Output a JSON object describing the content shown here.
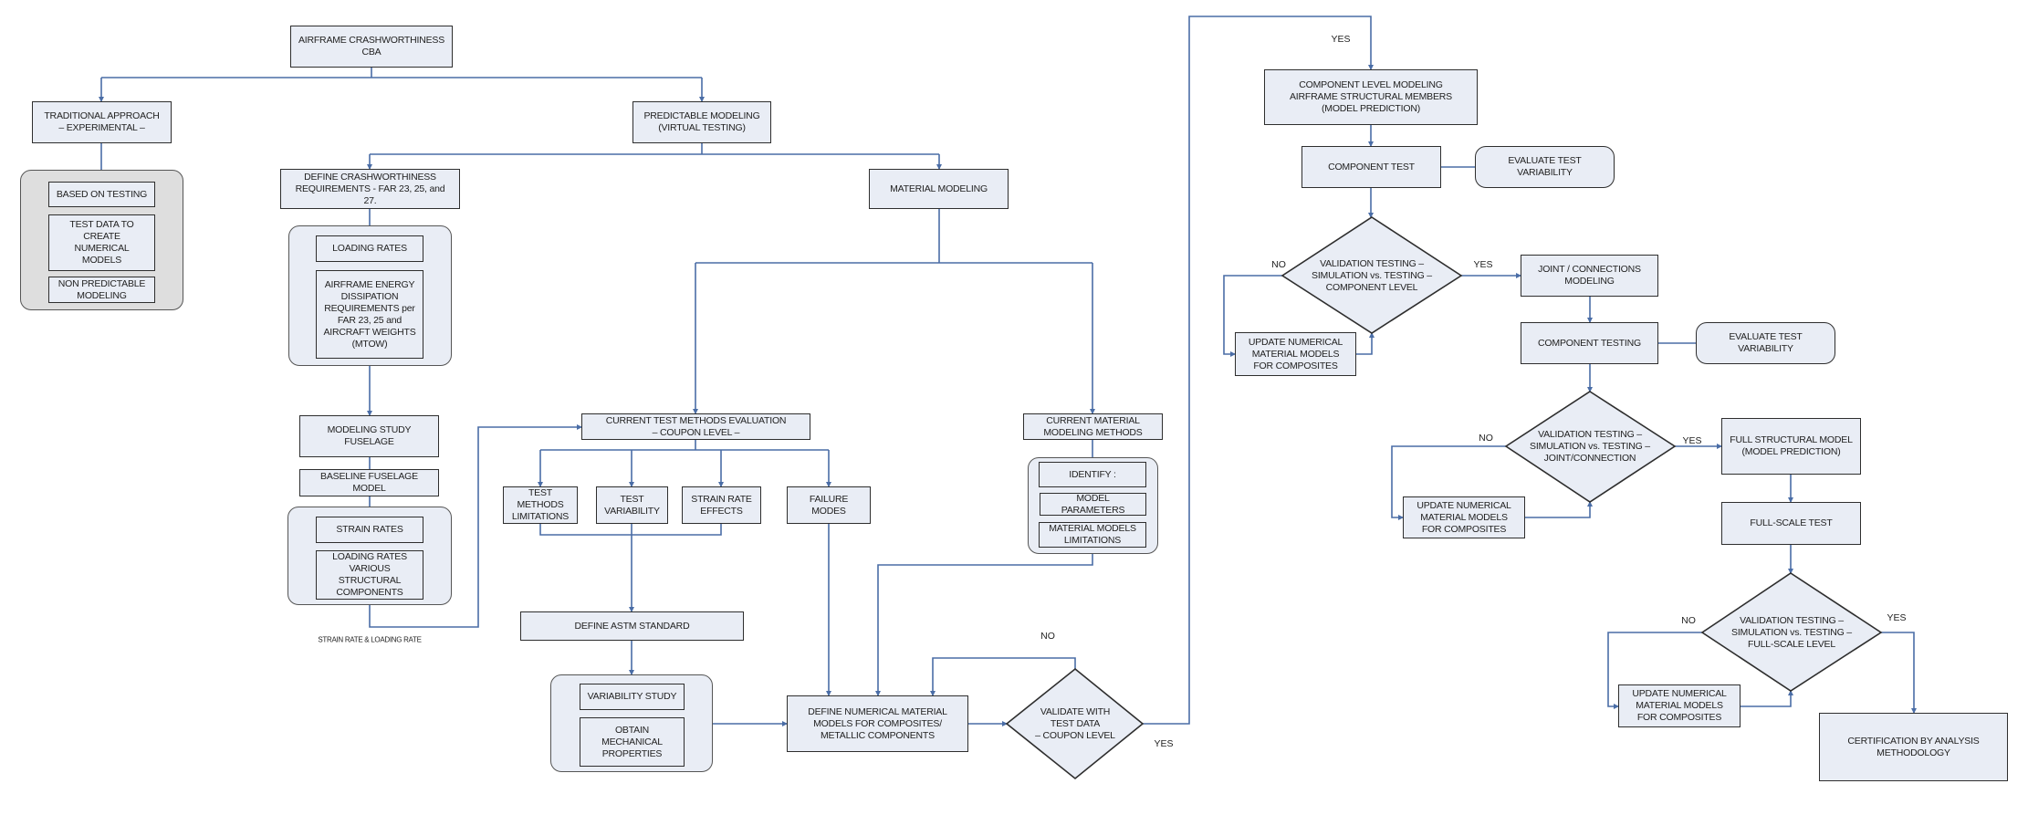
{
  "colors": {
    "box_fill": "#e9edf5",
    "group_gray": "#dedede",
    "connector": "#4a6da6",
    "border": "#2e2e2e"
  },
  "nodes": {
    "root": "AIRFRAME CRASHWORTHINESS\nCBA",
    "traditional": "TRADITIONAL APPROACH\n– EXPERIMENTAL –",
    "based_on_testing": "BASED ON TESTING",
    "test_data": "TEST DATA TO\nCREATE\nNUMERICAL\nMODELS",
    "non_predictable": "NON PREDICTABLE\nMODELING",
    "predictable": "PREDICTABLE MODELING\n(VIRTUAL TESTING)",
    "define_requirements": "DEFINE CRASHWORTHINESS\nREQUIREMENTS -  FAR 23, 25, and\n27.",
    "loading_rates": "LOADING RATES",
    "energy_dissipation": "AIRFRAME ENERGY\nDISSIPATION\nREQUIREMENTS per\nFAR 23, 25 and\nAIRCRAFT WEIGHTS\n(MTOW)",
    "material_modeling": "MATERIAL MODELING",
    "modeling_study": "MODELING STUDY\nFUSELAGE",
    "baseline_fuselage": "BASELINE FUSELAGE\nMODEL",
    "strain_rates": "STRAIN RATES",
    "loading_rates_components": "LOADING RATES\nVARIOUS\nSTRUCTURAL\nCOMPONENTS",
    "strain_loading_label": "STRAIN RATE & LOADING RATE",
    "current_test_methods": "CURRENT TEST METHODS EVALUATION\n– COUPON LEVEL –",
    "test_methods_limitations": "TEST\nMETHODS\nLIMITATIONS",
    "test_variability": "TEST\nVARIABILITY",
    "strain_rate_effects": "STRAIN RATE\nEFFECTS",
    "failure_modes": "FAILURE\nMODES",
    "define_astm": "DEFINE ASTM STANDARD",
    "variability_study": "VARIABILITY STUDY",
    "obtain_properties": "OBTAIN\nMECHANICAL\nPROPERTIES",
    "current_material_methods": "CURRENT MATERIAL\nMODELING METHODS",
    "identify": "IDENTIFY :",
    "model_parameters": "MODEL\nPARAMETERS",
    "material_limitations": "MATERIAL MODELS\nLIMITATIONS",
    "define_numerical": "DEFINE NUMERICAL MATERIAL\nMODELS FOR COMPOSITES/\nMETALLIC COMPONENTS",
    "validate_coupon": "VALIDATE WITH\nTEST DATA\n– COUPON LEVEL",
    "component_level": "COMPONENT LEVEL MODELING\nAIRFRAME STRUCTURAL MEMBERS\n(MODEL PREDICTION)",
    "component_test": "COMPONENT TEST",
    "evaluate_variability_1": "EVALUATE TEST\nVARIABILITY",
    "validation_component": "VALIDATION TESTING –\nSIMULATION vs. TESTING –\nCOMPONENT LEVEL",
    "update_1": "UPDATE NUMERICAL\nMATERIAL MODELS\nFOR COMPOSITES",
    "joint_modeling": "JOINT / CONNECTIONS\nMODELING",
    "component_testing": "COMPONENT TESTING",
    "evaluate_variability_2": "EVALUATE TEST\nVARIABILITY",
    "validation_joint": "VALIDATION TESTING –\nSIMULATION vs. TESTING –\nJOINT/CONNECTION",
    "update_2": "UPDATE NUMERICAL\nMATERIAL MODELS\nFOR COMPOSITES",
    "full_structural": "FULL STRUCTURAL MODEL\n(MODEL PREDICTION)",
    "full_scale_test": "FULL-SCALE TEST",
    "validation_full_scale": "VALIDATION TESTING –\nSIMULATION vs. TESTING –\nFULL-SCALE LEVEL",
    "update_3": "UPDATE NUMERICAL\nMATERIAL MODELS\nFOR COMPOSITES",
    "certification": "CERTIFICATION BY ANALYSIS\nMETHODOLOGY"
  },
  "edge_labels": {
    "coupon_no": "NO",
    "coupon_yes": "YES",
    "top_yes": "YES",
    "component_no": "NO",
    "component_yes": "YES",
    "joint_no": "NO",
    "joint_yes": "YES",
    "full_no": "NO",
    "full_yes": "YES"
  }
}
